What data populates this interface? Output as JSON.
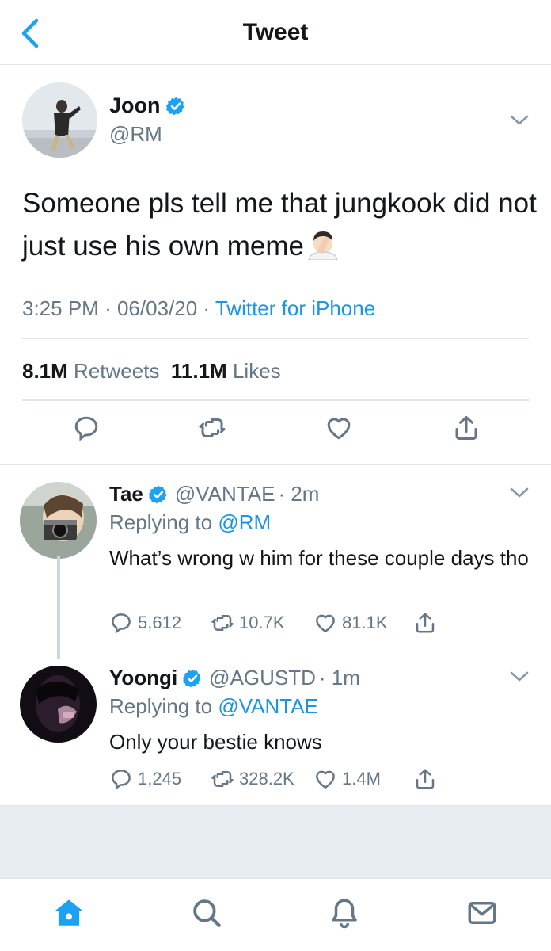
{
  "nav": {
    "title": "Tweet",
    "back_icon": "chevron-left-icon"
  },
  "colors": {
    "accent": "#1da1f2",
    "link": "#1b95e0",
    "text": "#14171a",
    "secondary": "#657786",
    "divider": "#dfe4e8",
    "background_band": "#e6ecf0"
  },
  "main_tweet": {
    "name": "Joon",
    "handle": "@RM",
    "verified": true,
    "text": "Someone pls tell me that jungkook did not just use his own meme",
    "emoji": "facepalm",
    "time": "3:25 PM",
    "date": "06/03/20",
    "separator": "·",
    "source": "Twitter for iPhone",
    "retweets_count": "8.1M",
    "retweets_label": "Retweets",
    "likes_count": "11.1M",
    "likes_label": "Likes",
    "actions": [
      "reply-icon",
      "retweet-icon",
      "like-icon",
      "share-icon"
    ]
  },
  "replies": [
    {
      "name": "Tae",
      "handle": "@VANTAE",
      "time": "· 2m",
      "verified": true,
      "replying_label": "Replying to",
      "replying_to": "@RM",
      "text": "What’s wrong w him for these couple days tho",
      "reply_count": "5,612",
      "retweet_count": "10.7K",
      "like_count": "81.1K"
    },
    {
      "name": "Yoongi",
      "handle": "@AGUSTD",
      "time": "· 1m",
      "verified": true,
      "replying_label": "Replying to",
      "replying_to": "@VANTAE",
      "text": "Only your bestie knows",
      "reply_count": "1,245",
      "retweet_count": "328.2K",
      "like_count": "1.4M"
    }
  ],
  "tabbar": {
    "tabs": [
      {
        "icon": "home-icon",
        "active": true
      },
      {
        "icon": "search-icon",
        "active": false
      },
      {
        "icon": "notifications-icon",
        "active": false
      },
      {
        "icon": "messages-icon",
        "active": false
      }
    ]
  }
}
